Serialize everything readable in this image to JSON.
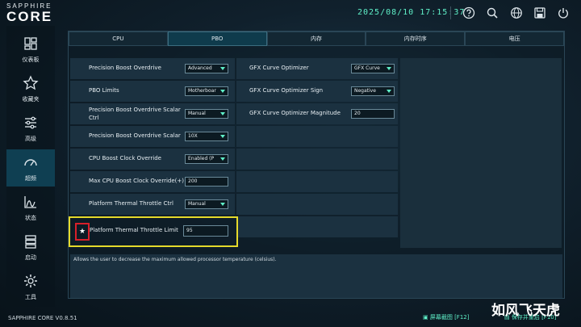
{
  "app": {
    "brand_small": "SAPPHIRE",
    "brand_big": "CORE",
    "datetime": "2025/08/10 17:15:37",
    "version": "SAPPHIRE CORE V0.8.51"
  },
  "toolbar": {
    "icons": [
      "help-icon",
      "search-icon",
      "globe-icon",
      "save-icon",
      "power-icon"
    ]
  },
  "sidebar": {
    "items": [
      {
        "label": "仪表板",
        "icon": "dashboard-icon"
      },
      {
        "label": "收藏夹",
        "icon": "star-icon"
      },
      {
        "label": "高级",
        "icon": "sliders-icon"
      },
      {
        "label": "超频",
        "icon": "gauge-icon",
        "active": true
      },
      {
        "label": "状态",
        "icon": "chart-icon"
      },
      {
        "label": "启动",
        "icon": "boot-icon"
      },
      {
        "label": "工具",
        "icon": "gear-icon"
      }
    ]
  },
  "tabs": [
    {
      "label": "CPU"
    },
    {
      "label": "PBO",
      "active": true
    },
    {
      "label": "内存"
    },
    {
      "label": "内存时序"
    },
    {
      "label": "电压"
    }
  ],
  "left_settings": [
    {
      "label": "Precision Boost Overdrive",
      "type": "select",
      "value": "Advanced"
    },
    {
      "label": "PBO Limits",
      "type": "select",
      "value": "Motherboar"
    },
    {
      "label": "Precision Boost Overdrive Scalar Ctrl",
      "type": "select",
      "value": "Manual"
    },
    {
      "label": "Precision Boost Overdrive Scalar",
      "type": "select",
      "value": "10X"
    },
    {
      "label": "CPU Boost Clock Override",
      "type": "select",
      "value": "Enabled (P"
    },
    {
      "label": "Max CPU Boost Clock Override(+)",
      "type": "input",
      "value": "200"
    },
    {
      "label": "Platform Thermal Throttle Ctrl",
      "type": "select",
      "value": "Manual"
    }
  ],
  "highlighted_setting": {
    "label": "Platform Thermal Throttle Limit",
    "value": "95",
    "favorite_icon": "star-icon"
  },
  "right_settings": [
    {
      "label": "GFX Curve Optimizer",
      "type": "select",
      "value": "GFX Curve"
    },
    {
      "label": "GFX Curve Optimizer Sign",
      "type": "select",
      "value": "Negative"
    },
    {
      "label": "GFX Curve Optimizer Magnitude",
      "type": "input",
      "value": "20"
    }
  ],
  "description": "Allows the user to decrease the maximum allowed processor temperature (celsius).",
  "bottom": {
    "screenshot_label": "屏幕截图 [F12]",
    "save_exit_label": "保存并重启 [F10]"
  },
  "watermark": "如风飞天虎",
  "colors": {
    "accent": "#5ff0c8",
    "highlight_border": "#e5da2b",
    "favorite_border": "#d8202a"
  }
}
